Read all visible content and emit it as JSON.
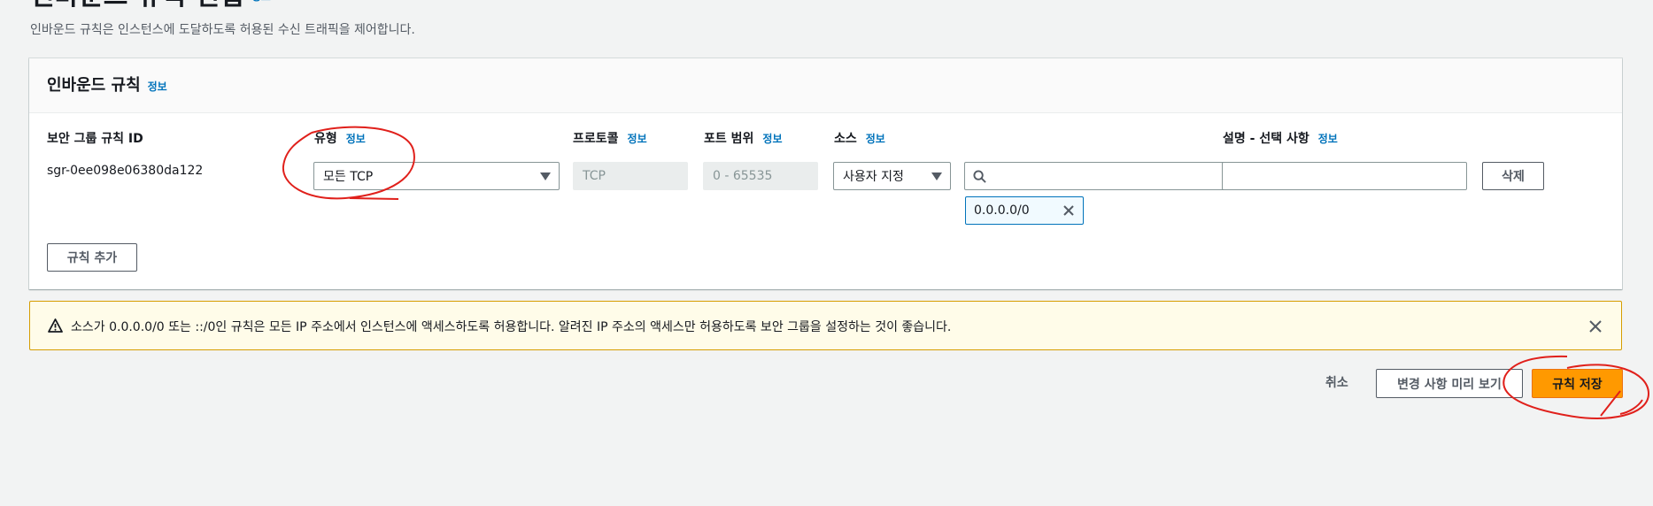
{
  "page": {
    "title": "인바운드 규칙 편집",
    "title_info": "정보",
    "description": "인바운드 규칙은 인스턴스에 도달하도록 허용된 수신 트래픽을 제어합니다."
  },
  "panel": {
    "title": "인바운드 규칙",
    "title_info": "정보",
    "columns": {
      "rule_id": "보안 그룹 규칙 ID",
      "type": "유형",
      "protocol": "프로토콜",
      "port_range": "포트 범위",
      "source": "소스",
      "description": "설명 - 선택 사항",
      "info": "정보"
    },
    "rule": {
      "id": "sgr-0ee098e06380da122",
      "type": "모든 TCP",
      "protocol": "TCP",
      "port_range": "0 - 65535",
      "source_type": "사용자 지정",
      "source_search": "",
      "source_token": "0.0.0.0/0",
      "description": ""
    },
    "delete_label": "삭제",
    "add_rule_label": "규칙 추가"
  },
  "alert": {
    "message": "소스가 0.0.0.0/0 또는 ::/0인 규칙은 모든 IP 주소에서 인스턴스에 액세스하도록 허용합니다. 알려진 IP 주소의 액세스만 허용하도록 보안 그룹을 설정하는 것이 좋습니다.",
    "color": "#d69d00"
  },
  "footer": {
    "cancel_label": "취소",
    "preview_label": "변경 사항 미리 보기",
    "save_label": "규칙 저장"
  },
  "colors": {
    "primary": "#ff9900",
    "link": "#0073bb",
    "annotation": "#e0201b"
  }
}
